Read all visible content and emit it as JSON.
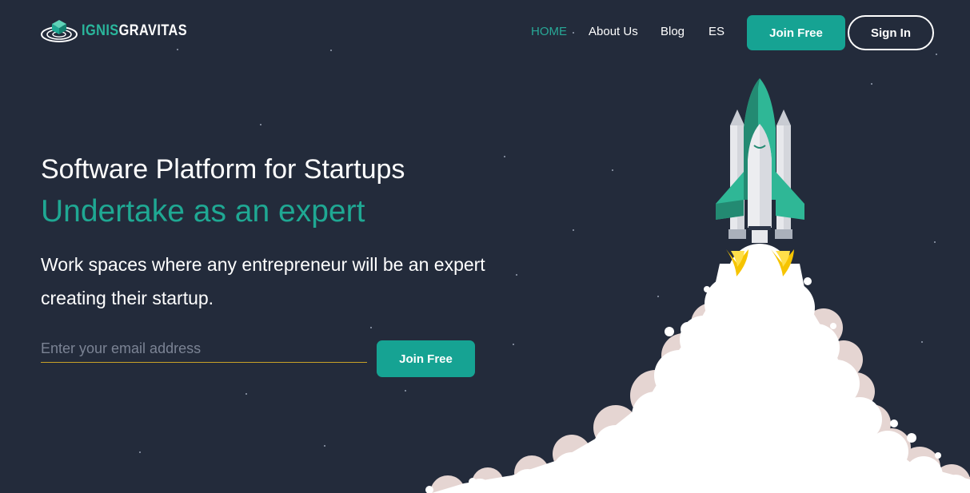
{
  "header": {
    "logo": {
      "part1": "IGNIS",
      "part2": "GRAVITAS"
    },
    "nav": [
      {
        "label": "HOME",
        "active": true
      },
      {
        "label": "About Us",
        "active": false
      },
      {
        "label": "Blog",
        "active": false
      },
      {
        "label": "ES",
        "active": false
      }
    ],
    "join_label": "Join Free",
    "signin_label": "Sign In"
  },
  "hero": {
    "title": "Software Platform for Startups",
    "subtitle": "Undertake as an expert",
    "description": "Work spaces where any entrepreneur will be an expert creating their startup.",
    "email_placeholder": "Enter your email address",
    "email_value": "",
    "join_label": "Join Free"
  },
  "colors": {
    "background": "#232b3b",
    "accent": "#16a393",
    "accent_text": "#1fa893",
    "input_underline": "#c9a227"
  },
  "icons": {
    "logo": "portal-cube-logo-icon",
    "illustration": "rocket-launch-illustration"
  }
}
